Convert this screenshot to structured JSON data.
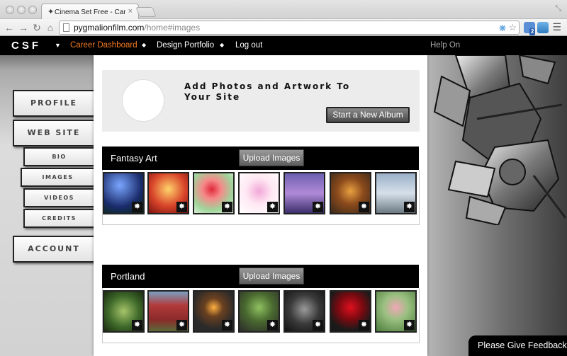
{
  "browser": {
    "tab_title": "Cinema Set Free - Career D",
    "url_host": "pygmalionfilm.com",
    "url_path": "/home#images",
    "extension_badge": "2"
  },
  "sitenav": {
    "logo": "CSF",
    "links": [
      "Career Dashboard",
      "Design Portfolio",
      "Log out"
    ],
    "help": "Help On"
  },
  "sidebar": {
    "items": [
      {
        "label": "Profile"
      },
      {
        "label": "Web Site"
      },
      {
        "label": "Bio"
      },
      {
        "label": "Images"
      },
      {
        "label": "Videos"
      },
      {
        "label": "Credits"
      },
      {
        "label": "Account"
      }
    ]
  },
  "promo": {
    "title": "Add Photos and Artwork To Your Site",
    "button": "Start a New Album"
  },
  "albums": [
    {
      "title": "Fantasy Art",
      "upload_label": "Upload Images",
      "thumbs": [
        "night-sky",
        "fire-angel",
        "red-flower-fairy",
        "pink-fairy",
        "purple-sky-birds",
        "dragon",
        "cloudy-figure"
      ]
    },
    {
      "title": "Portland",
      "upload_label": "Upload Images",
      "thumbs": [
        "green-foliage",
        "red-house",
        "fire-pit",
        "potted-plant",
        "dark-portrait",
        "red-rose",
        "pink-buds"
      ]
    }
  ],
  "feedback": "Please Give Feedback",
  "colors": {
    "nav_active": "#f47a1f",
    "nav_bg": "#000000"
  }
}
